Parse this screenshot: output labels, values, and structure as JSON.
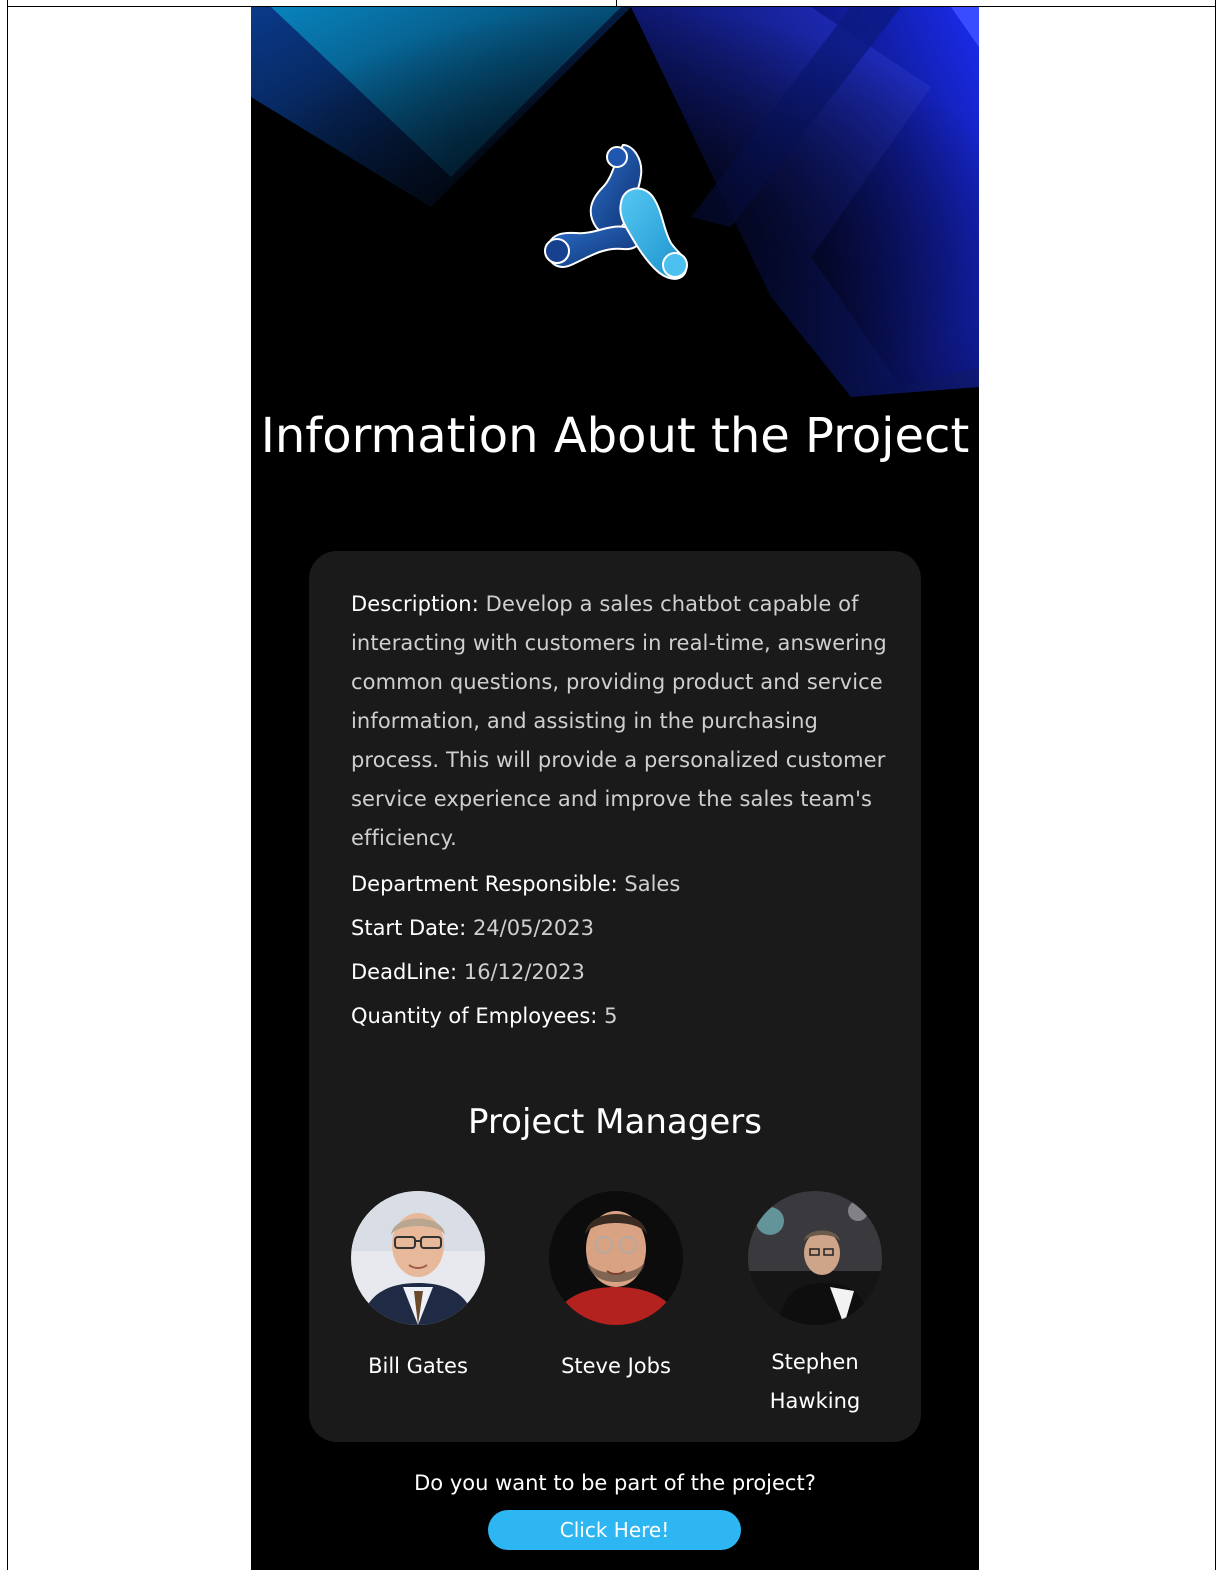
{
  "header": {
    "title": "Information About the Project"
  },
  "project": {
    "description_label": "Description:",
    "description": "Develop a sales chatbot capable of interacting with customers in real-time, answering common questions, providing product and service information, and assisting in the purchasing process. This will provide a personalized customer service experience and improve the sales team's efficiency.",
    "department_label": "Department Responsible:",
    "department": "Sales",
    "start_label": "Start Date:",
    "start_date": "24/05/2023",
    "deadline_label": "DeadLine:",
    "deadline": "16/12/2023",
    "employees_label": "Quantity of Employees:",
    "employees": "5"
  },
  "managers": {
    "title": "Project Managers",
    "items": [
      {
        "name": "Bill Gates"
      },
      {
        "name": "Steve Jobs"
      },
      {
        "name": "Stephen Hawking"
      }
    ]
  },
  "cta": {
    "question": "Do you want to be part of the project?",
    "button_label": "Click Here!"
  },
  "colors": {
    "background": "#000000",
    "card": "#1b1a1b",
    "accent": "#2eb6f3",
    "hero_blue": "#1b2ee0",
    "logo_light": "#3fb6e8",
    "logo_dark": "#1a3f8a"
  },
  "icons": {
    "logo": "molecule-logo-icon"
  }
}
